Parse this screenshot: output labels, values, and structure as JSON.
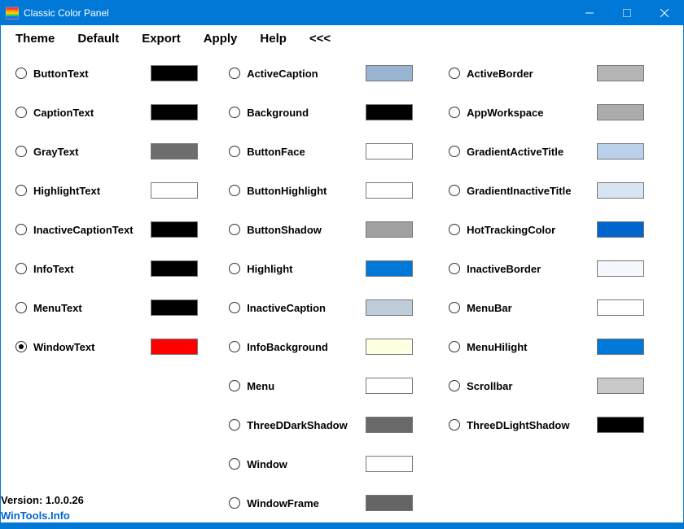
{
  "window": {
    "title": "Classic Color Panel"
  },
  "menubar": {
    "items": [
      "Theme",
      "Default",
      "Export",
      "Apply",
      "Help",
      "<<<"
    ]
  },
  "footer": {
    "version_label": "Version: 1.0.0.26",
    "link_label": "WinTools.Info"
  },
  "columns": [
    [
      {
        "name": "ButtonText",
        "color": "#000000",
        "selected": false
      },
      {
        "name": "CaptionText",
        "color": "#000000",
        "selected": false
      },
      {
        "name": "GrayText",
        "color": "#6D6D6D",
        "selected": false
      },
      {
        "name": "HighlightText",
        "color": "#FFFFFF",
        "selected": false
      },
      {
        "name": "InactiveCaptionText",
        "color": "#000000",
        "selected": false
      },
      {
        "name": "InfoText",
        "color": "#000000",
        "selected": false
      },
      {
        "name": "MenuText",
        "color": "#000000",
        "selected": false
      },
      {
        "name": "WindowText",
        "color": "#FF0000",
        "selected": true
      }
    ],
    [
      {
        "name": "ActiveCaption",
        "color": "#99B4D1",
        "selected": false
      },
      {
        "name": "Background",
        "color": "#000000",
        "selected": false
      },
      {
        "name": "ButtonFace",
        "color": "#FFFFFF",
        "selected": false
      },
      {
        "name": "ButtonHighlight",
        "color": "#FFFFFF",
        "selected": false
      },
      {
        "name": "ButtonShadow",
        "color": "#A0A0A0",
        "selected": false
      },
      {
        "name": "Highlight",
        "color": "#0078D7",
        "selected": false
      },
      {
        "name": "InactiveCaption",
        "color": "#BFCDDB",
        "selected": false
      },
      {
        "name": "InfoBackground",
        "color": "#FFFFE1",
        "selected": false
      },
      {
        "name": "Menu",
        "color": "#FFFFFF",
        "selected": false
      },
      {
        "name": "ThreeDDarkShadow",
        "color": "#696969",
        "selected": false
      },
      {
        "name": "Window",
        "color": "#FFFFFF",
        "selected": false
      },
      {
        "name": "WindowFrame",
        "color": "#646464",
        "selected": false
      }
    ],
    [
      {
        "name": "ActiveBorder",
        "color": "#B4B4B4",
        "selected": false
      },
      {
        "name": "AppWorkspace",
        "color": "#ABABAB",
        "selected": false
      },
      {
        "name": "GradientActiveTitle",
        "color": "#B9D1EA",
        "selected": false
      },
      {
        "name": "GradientInactiveTitle",
        "color": "#D7E4F2",
        "selected": false
      },
      {
        "name": "HotTrackingColor",
        "color": "#0066CC",
        "selected": false
      },
      {
        "name": "InactiveBorder",
        "color": "#F4F7FC",
        "selected": false
      },
      {
        "name": "MenuBar",
        "color": "#FFFFFF",
        "selected": false
      },
      {
        "name": "MenuHilight",
        "color": "#0078D7",
        "selected": false
      },
      {
        "name": "Scrollbar",
        "color": "#C8C8C8",
        "selected": false
      },
      {
        "name": "ThreeDLightShadow",
        "color": "#000000",
        "selected": false
      }
    ]
  ]
}
